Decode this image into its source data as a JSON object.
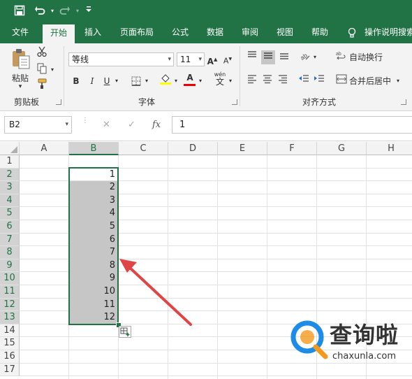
{
  "ribbon_tabs": [
    {
      "label": "文件",
      "active": false
    },
    {
      "label": "开始",
      "active": true
    },
    {
      "label": "插入",
      "active": false
    },
    {
      "label": "页面布局",
      "active": false
    },
    {
      "label": "公式",
      "active": false
    },
    {
      "label": "数据",
      "active": false
    },
    {
      "label": "审阅",
      "active": false
    },
    {
      "label": "视图",
      "active": false
    },
    {
      "label": "帮助",
      "active": false
    }
  ],
  "tell_me": "操作说明搜索",
  "clipboard": {
    "paste_label": "粘贴",
    "group_label": "剪贴板"
  },
  "font": {
    "name": "等线",
    "size": "11",
    "group_label": "字体",
    "bold": "B",
    "italic": "I",
    "underline": "U",
    "grow": "A",
    "shrink": "A",
    "font_color_letter": "A",
    "phonetic": "wén"
  },
  "alignment": {
    "wrap_label": "自动换行",
    "merge_label": "合并后居中",
    "group_label": "对齐方式"
  },
  "formula_bar": {
    "name_box": "B2",
    "fx": "fx",
    "value": "1"
  },
  "columns": [
    "A",
    "B",
    "C",
    "D",
    "E",
    "F",
    "G",
    "H"
  ],
  "selected_column": "B",
  "rows": [
    "1",
    "2",
    "3",
    "4",
    "5",
    "6",
    "7",
    "8",
    "9",
    "10",
    "11",
    "12",
    "13",
    "14",
    "15",
    "16",
    "17"
  ],
  "selected_rows": [
    "2",
    "3",
    "4",
    "5",
    "6",
    "7",
    "8",
    "9",
    "10",
    "11",
    "12",
    "13"
  ],
  "column_b_values": [
    "",
    "1",
    "2",
    "3",
    "4",
    "5",
    "6",
    "7",
    "8",
    "9",
    "10",
    "11",
    "12",
    "",
    "",
    "",
    ""
  ],
  "watermark": {
    "name": "查询啦",
    "url": "chaxunla.com"
  },
  "colors": {
    "excel_green": "#217346",
    "selection_fill": "#c6c6c6",
    "arrow_red": "#e04545",
    "watermark_blue": "#1c8ce6",
    "watermark_orange": "#f39a1e"
  }
}
